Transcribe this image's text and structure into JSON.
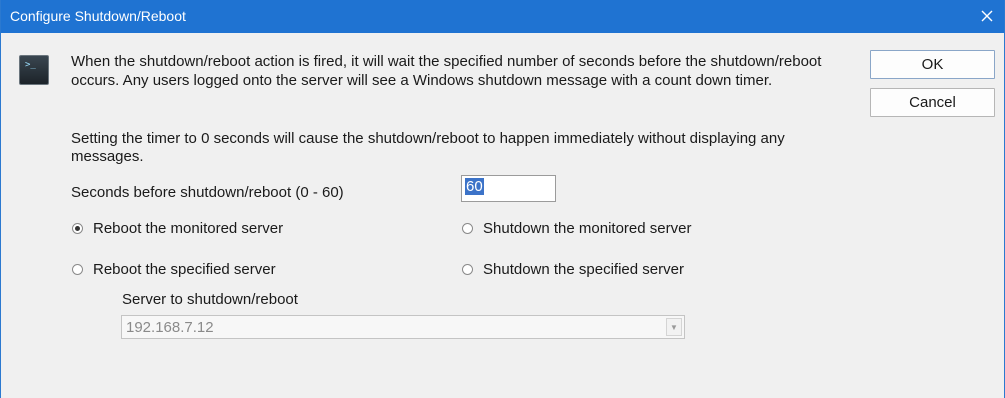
{
  "window": {
    "title": "Configure Shutdown/Reboot",
    "close_icon": "close-icon"
  },
  "info": {
    "icon": "terminal-icon",
    "prompt_glyph": ">_",
    "description": "When the shutdown/reboot action is fired, it will wait the specified number of seconds before the shutdown/reboot occurs.  Any users logged onto the server will see a Windows shutdown message with a count down timer.",
    "note": "Setting the timer to 0 seconds will cause the shutdown/reboot to happen immediately without displaying any messages."
  },
  "buttons": {
    "ok": "OK",
    "cancel": "Cancel"
  },
  "seconds": {
    "label": "Seconds before shutdown/reboot (0 - 60)",
    "value": "60"
  },
  "options": [
    {
      "label": "Reboot the monitored server",
      "selected": true
    },
    {
      "label": "Shutdown the monitored server",
      "selected": false
    },
    {
      "label": "Reboot the specified server",
      "selected": false
    },
    {
      "label": "Shutdown the specified server",
      "selected": false
    }
  ],
  "server": {
    "label": "Server to shutdown/reboot",
    "value": "192.168.7.12",
    "disabled": true
  },
  "colors": {
    "titlebar": "#1f73d2",
    "dialog_bg": "#f0f0f0",
    "selection": "#3c73c8"
  }
}
